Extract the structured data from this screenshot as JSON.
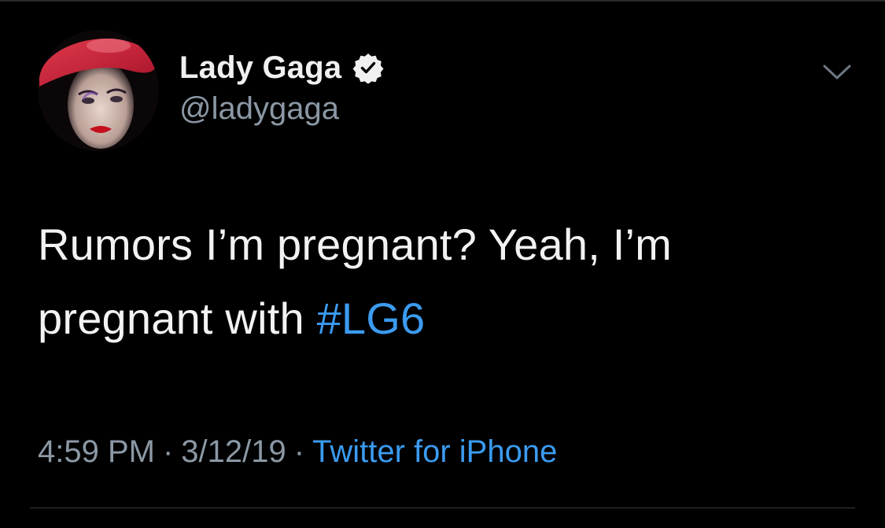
{
  "tweet": {
    "author": {
      "name": "Lady Gaga",
      "handle": "@ladygaga",
      "verified_icon": "verified-badge-icon",
      "avatar_icon": "avatar"
    },
    "text_before": "Rumors I’m pregnant? Yeah, I’m pregnant with ",
    "hashtag": "#LG6",
    "time": "4:59 PM",
    "separator1": "·",
    "date": "3/12/19",
    "separator2": "·",
    "source": "Twitter for iPhone",
    "more_icon": "chevron-down-icon"
  },
  "colors": {
    "background": "#000000",
    "text": "#f2f2f2",
    "secondary": "#8b98a5",
    "accent": "#3b9bf0"
  }
}
